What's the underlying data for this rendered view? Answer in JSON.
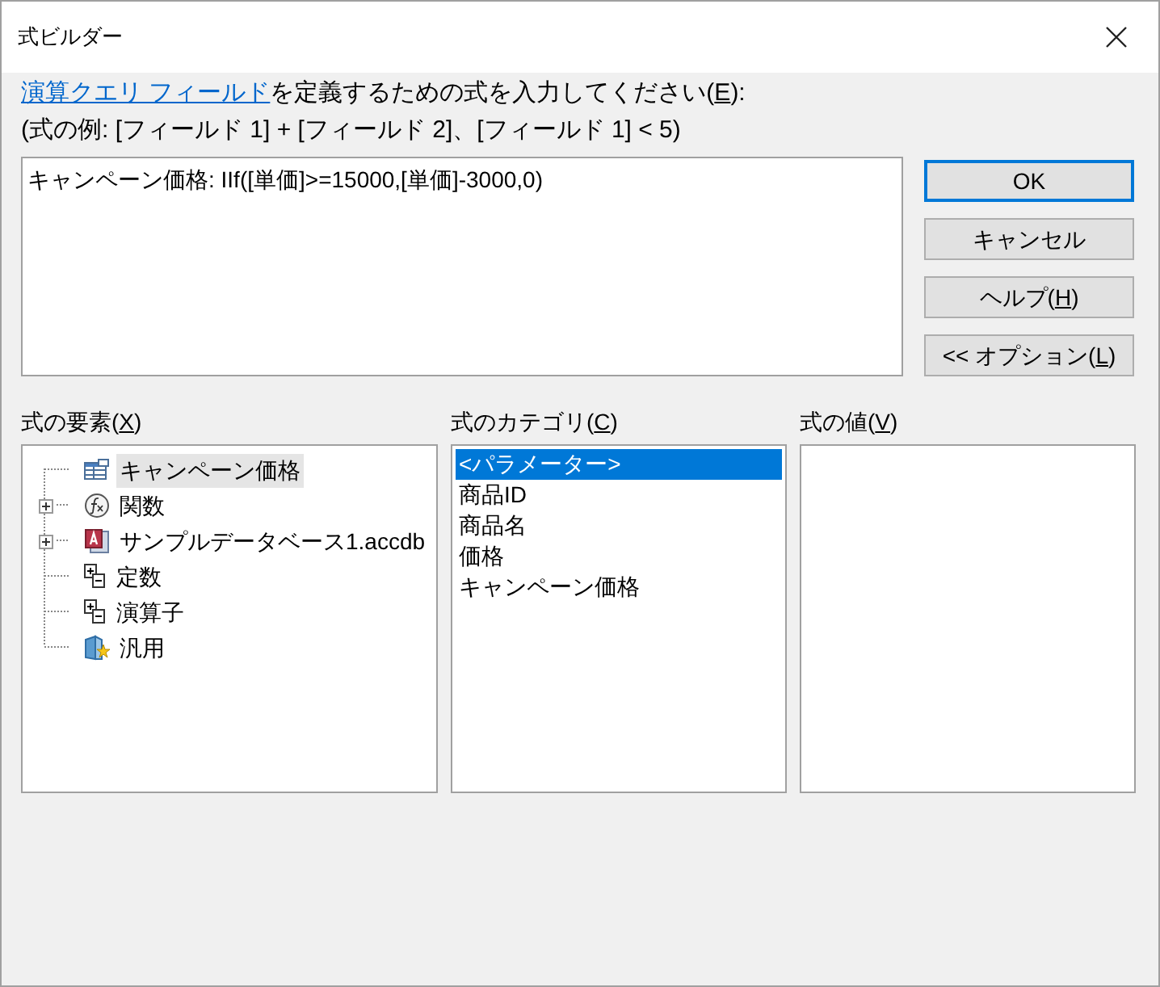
{
  "window": {
    "title": "式ビルダー"
  },
  "instruction": {
    "link": "演算クエリ フィールド",
    "before": "を定義するための式を入力してください(",
    "key": "E",
    "after": "):"
  },
  "example": "(式の例: [フィールド 1] + [フィールド 2]、[フィールド 1] < 5)",
  "expression": {
    "value": "キャンペーン価格: IIf([単価]>=15000,[単価]-3000,0)"
  },
  "buttons": [
    {
      "before": "OK",
      "default": true
    },
    {
      "before": "キャンセル",
      "default": false
    },
    {
      "before": "ヘルプ(",
      "key": "H",
      "after": ")",
      "default": false
    },
    {
      "before": "<< オプション(",
      "key": "L",
      "after": ")",
      "default": false
    }
  ],
  "elements": {
    "label": {
      "before": "式の要素(",
      "key": "X",
      "after": ")"
    },
    "items": [
      {
        "kind": "field",
        "label": "キャンペーン価格",
        "expandable": false,
        "selected": true
      },
      {
        "kind": "function",
        "label": "関数",
        "expandable": true,
        "selected": false
      },
      {
        "kind": "database",
        "label": "サンプルデータベース1.accdb",
        "expandable": true,
        "selected": false
      },
      {
        "kind": "constant",
        "label": "定数",
        "expandable": false,
        "selected": false
      },
      {
        "kind": "constant",
        "label": "演算子",
        "expandable": false,
        "selected": false
      },
      {
        "kind": "general",
        "label": "汎用",
        "expandable": false,
        "selected": false
      }
    ]
  },
  "categories": {
    "label": {
      "before": "式のカテゴリ(",
      "key": "C",
      "after": ")"
    },
    "items": [
      {
        "label": "<パラメーター>",
        "selected": true
      },
      {
        "label": "商品ID",
        "selected": false
      },
      {
        "label": "商品名",
        "selected": false
      },
      {
        "label": "価格",
        "selected": false
      },
      {
        "label": "キャンペーン価格",
        "selected": false
      }
    ]
  },
  "values": {
    "label": {
      "before": "式の値(",
      "key": "V",
      "after": ")"
    }
  }
}
